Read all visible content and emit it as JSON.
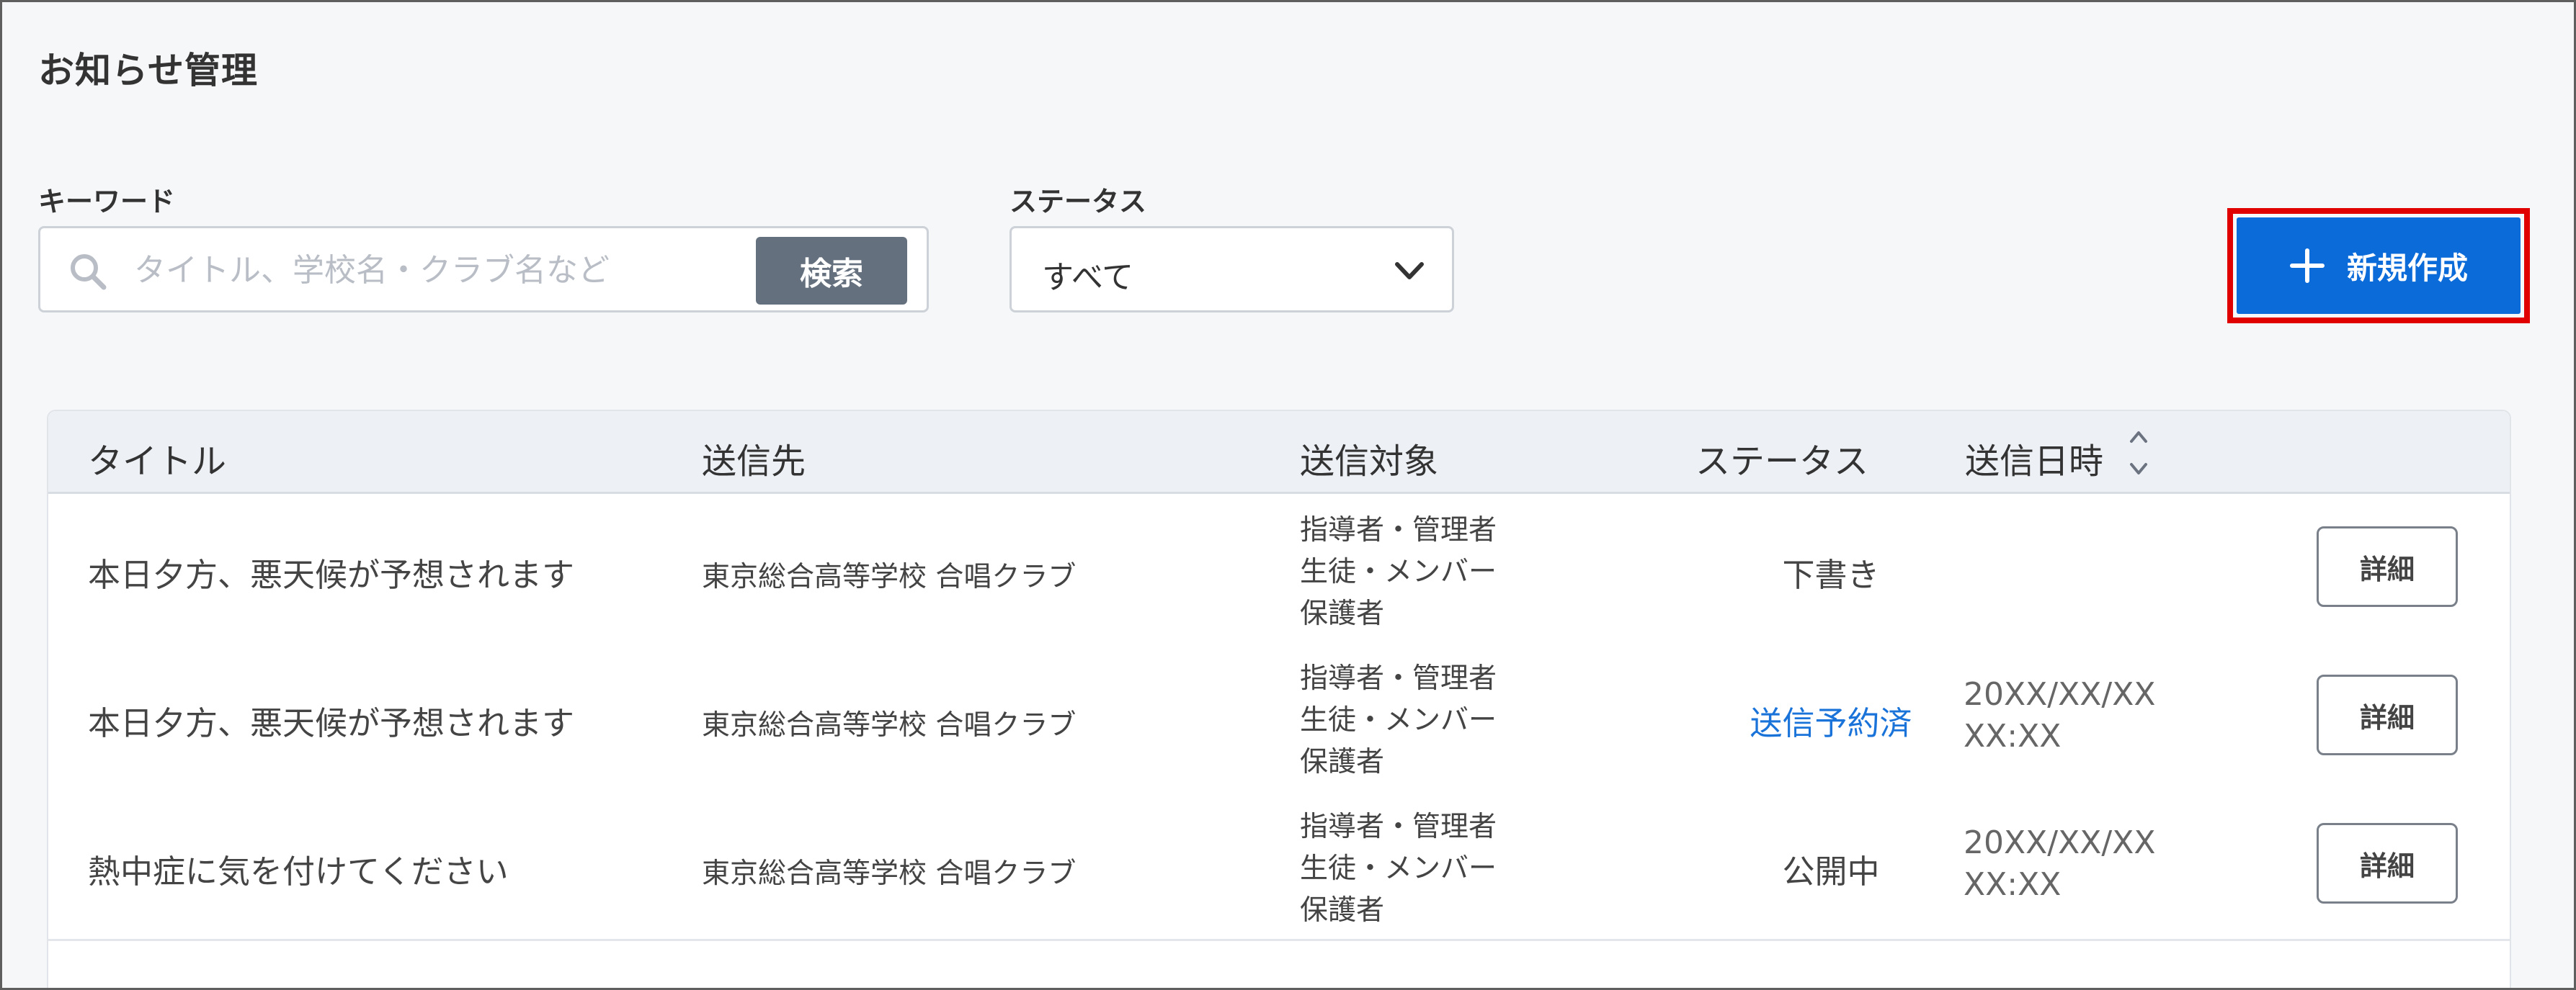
{
  "page": {
    "title": "お知らせ管理"
  },
  "filters": {
    "keyword_label": "キーワード",
    "keyword_placeholder": "タイトル、学校名・クラブ名など",
    "keyword_value": "",
    "search_button": "検索",
    "status_label": "ステータス",
    "status_selected": "すべて"
  },
  "actions": {
    "new_label": "新規作成",
    "highlight_color": "#e00000",
    "primary_color": "#0b6bd9"
  },
  "table": {
    "headers": {
      "title": "タイトル",
      "destination": "送信先",
      "targets": "送信対象",
      "status": "ステータス",
      "sent_at": "送信日時"
    },
    "detail_label": "詳細",
    "rows": [
      {
        "title": "本日夕方、悪天候が予想されます",
        "destination": "東京総合高等学校 合唱クラブ",
        "targets": [
          "指導者・管理者",
          "生徒・メンバー",
          "保護者"
        ],
        "status": "下書き",
        "date": "",
        "time": ""
      },
      {
        "title": "本日夕方、悪天候が予想されます",
        "destination": "東京総合高等学校 合唱クラブ",
        "targets": [
          "指導者・管理者",
          "生徒・メンバー",
          "保護者"
        ],
        "status": "送信予約済",
        "date": "20XX/XX/XX",
        "time": "XX:XX"
      },
      {
        "title": "熱中症に気を付けてください",
        "destination": "東京総合高等学校 合唱クラブ",
        "targets": [
          "指導者・管理者",
          "生徒・メンバー",
          "保護者"
        ],
        "status": "公開中",
        "date": "20XX/XX/XX",
        "time": "XX:XX"
      }
    ]
  },
  "icons": {
    "search": "search-icon",
    "dropdown": "chevron-down-icon",
    "plus": "plus-icon",
    "sort": "sort-icon"
  }
}
